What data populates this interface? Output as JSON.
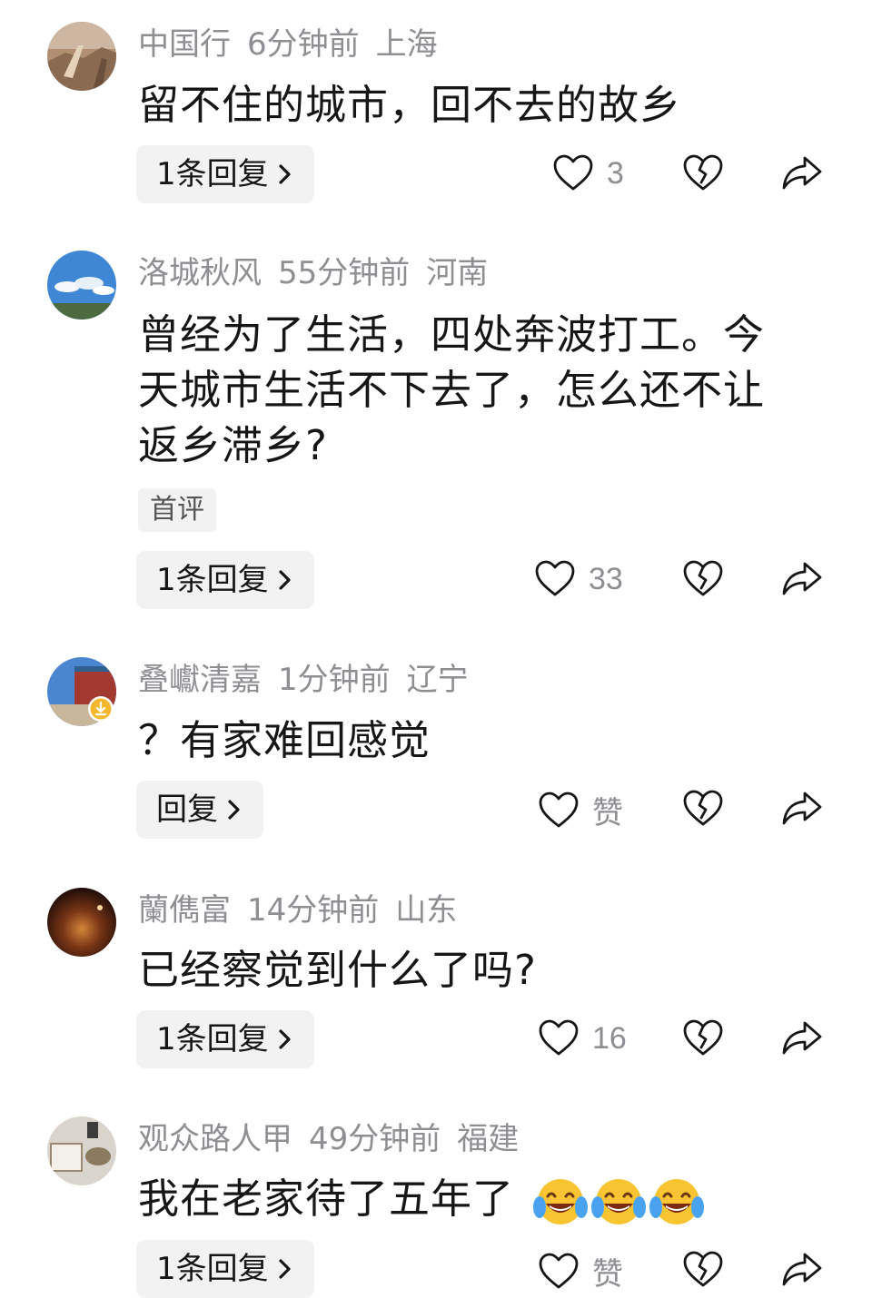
{
  "comments": [
    {
      "user": "中国行",
      "time": "6分钟前",
      "location": "上海",
      "text": "留不住的城市，回不去的故乡",
      "badge": "",
      "reply_label": "1条回复",
      "likes": "3",
      "avatar_colors": [
        "#c8a07a",
        "#8b6b52"
      ]
    },
    {
      "user": "洛城秋风",
      "time": "55分钟前",
      "location": "河南",
      "text": "曾经为了生活，四处奔波打工。今天城市生活不下去了，怎么还不让返乡滞乡?",
      "badge": "首评",
      "reply_label": "1条回复",
      "likes": "33",
      "avatar_colors": [
        "#4f8fd6",
        "#d0e4f5"
      ]
    },
    {
      "user": "叠巘清嘉",
      "time": "1分钟前",
      "location": "辽宁",
      "text": "？有家难回感觉",
      "badge": "",
      "reply_label": "回复",
      "likes": "赞",
      "avatar_colors": [
        "#3b73c4",
        "#a03030"
      ]
    },
    {
      "user": "蘭儁富",
      "time": "14分钟前",
      "location": "山东",
      "text": "已经察觉到什么了吗?",
      "badge": "",
      "reply_label": "1条回复",
      "likes": "16",
      "avatar_colors": [
        "#3a1a10",
        "#c4702a"
      ]
    },
    {
      "user": "观众路人甲",
      "time": "49分钟前",
      "location": "福建",
      "text": "我在老家待了五年了",
      "badge": "",
      "reply_label": "1条回复",
      "likes": "赞",
      "avatar_colors": [
        "#d8d4cc",
        "#7a6a55"
      ]
    }
  ],
  "icons": {
    "like": "heart-outline-icon",
    "dislike": "broken-heart-icon",
    "share": "share-arrow-icon",
    "emoji": "tears-of-joy-emoji"
  }
}
